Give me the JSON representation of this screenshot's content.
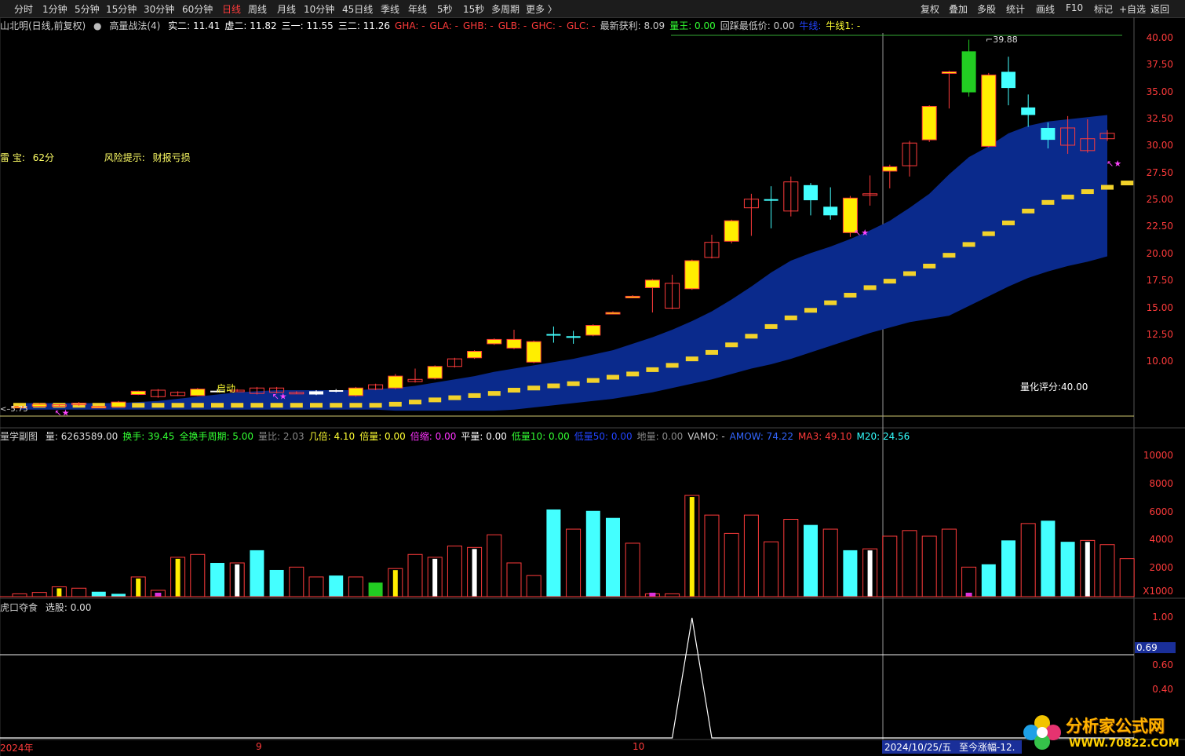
{
  "toolbar": {
    "timeframes": [
      {
        "label": "分时",
        "active": false
      },
      {
        "label": "1分钟",
        "active": false
      },
      {
        "label": "5分钟",
        "active": false
      },
      {
        "label": "15分钟",
        "active": false
      },
      {
        "label": "30分钟",
        "active": false
      },
      {
        "label": "60分钟",
        "active": false
      },
      {
        "label": "日线",
        "active": true
      },
      {
        "label": "周线",
        "active": false
      },
      {
        "label": "月线",
        "active": false
      },
      {
        "label": "10分钟",
        "active": false
      },
      {
        "label": "45日线",
        "active": false
      },
      {
        "label": "季线",
        "active": false
      },
      {
        "label": "年线",
        "active": false
      },
      {
        "label": "5秒",
        "active": false
      },
      {
        "label": "15秒",
        "active": false
      },
      {
        "label": "多周期",
        "active": false
      },
      {
        "label": "更多",
        "active": false
      }
    ],
    "more_arrow": "〉",
    "right_buttons": [
      "复权",
      "叠加",
      "多股",
      "统计",
      "画线",
      "F10",
      "标记",
      "+自选",
      "返回"
    ]
  },
  "main_header": {
    "stock": "山北明(日线,前复权)",
    "formula": "高量战法(4)",
    "items": [
      {
        "label": "实二: 11.41",
        "color": "#ffffff"
      },
      {
        "label": "虚二: 11.82",
        "color": "#ffffff"
      },
      {
        "label": "三一: 11.55",
        "color": "#ffffff"
      },
      {
        "label": "三二: 11.26",
        "color": "#ffffff"
      },
      {
        "label": "GHA: -",
        "color": "#ff3b3b"
      },
      {
        "label": "GLA: -",
        "color": "#ff3b3b"
      },
      {
        "label": "GHB: -",
        "color": "#ff3b3b"
      },
      {
        "label": "GLB: -",
        "color": "#ff3b3b"
      },
      {
        "label": "GHC: -",
        "color": "#ff3b3b"
      },
      {
        "label": "GLC: -",
        "color": "#ff3b3b"
      },
      {
        "label": "最新获利: 8.09",
        "color": "#cccccc"
      },
      {
        "label": "量王: 0.00",
        "color": "#33ff33"
      },
      {
        "label": "回踩最低价: 0.00",
        "color": "#cccccc"
      },
      {
        "label": "牛线:",
        "color": "#2244ff"
      },
      {
        "label": "牛线1: -",
        "color": "#ffff33"
      }
    ]
  },
  "leishen": {
    "label": "雷 宝:",
    "value": "62分",
    "risk_label": "风险提示:",
    "risk_value": "财报亏损"
  },
  "price_axis": [
    "40.00",
    "37.50",
    "35.00",
    "32.50",
    "30.00",
    "27.50",
    "25.00",
    "22.50",
    "20.00",
    "17.50",
    "15.00",
    "12.50",
    "10.00"
  ],
  "max_price_label": "39.88",
  "min_price_label": "5.75",
  "start_label": "启动",
  "quant_score": "量化评分:40.00",
  "volume_header": {
    "title": "量学副图",
    "items": [
      {
        "label": "量: 6263589.00",
        "color": "#dddddd"
      },
      {
        "label": "换手: 39.45",
        "color": "#33ff33"
      },
      {
        "label": "全换手周期: 5.00",
        "color": "#33ff33"
      },
      {
        "label": "量比: 2.03",
        "color": "#888888"
      },
      {
        "label": "几倍: 4.10",
        "color": "#ffff33"
      },
      {
        "label": "倍量: 0.00",
        "color": "#ffff33"
      },
      {
        "label": "倍缩: 0.00",
        "color": "#ff33ff"
      },
      {
        "label": "平量: 0.00",
        "color": "#ffffff"
      },
      {
        "label": "低量10: 0.00",
        "color": "#33ff33"
      },
      {
        "label": "低量50: 0.00",
        "color": "#2244ff"
      },
      {
        "label": "地量: 0.00",
        "color": "#888888"
      },
      {
        "label": "VAMO: -",
        "color": "#cccccc"
      },
      {
        "label": "AMOW: 74.22",
        "color": "#3366ff"
      },
      {
        "label": "MA3: 49.10",
        "color": "#ff3b3b"
      },
      {
        "label": "M20: 24.56",
        "color": "#33ffff"
      }
    ]
  },
  "volume_axis": [
    "10000",
    "8000",
    "6000",
    "4000",
    "2000"
  ],
  "volume_unit": "X1000",
  "signal_header": {
    "title": "虎口夺食",
    "item": "选股: 0.00"
  },
  "signal_axis": [
    "1.00",
    "0.60",
    "0.40"
  ],
  "signal_cursor_value": "0.69",
  "date_axis": [
    "2024年",
    "9",
    "10"
  ],
  "cursor_date": "2024/10/25/五",
  "cursor_note": "至今涨幅-12.",
  "watermark": {
    "title": "分析家公式网",
    "url": "WWW.70822.COM"
  },
  "chart_data": {
    "type": "candlestick",
    "candles": [
      {
        "o": 5.9,
        "c": 5.9,
        "h": 5.95,
        "l": 5.85,
        "kind": "up"
      },
      {
        "o": 5.9,
        "c": 6.1,
        "h": 6.2,
        "l": 5.85,
        "kind": "up"
      },
      {
        "o": 6.05,
        "c": 6.0,
        "h": 6.1,
        "l": 5.9,
        "kind": "mark"
      },
      {
        "o": 6.05,
        "c": 6.2,
        "h": 6.3,
        "l": 5.95,
        "kind": "down"
      },
      {
        "o": 5.9,
        "c": 5.9,
        "h": 5.95,
        "l": 5.8,
        "kind": "up"
      },
      {
        "o": 5.85,
        "c": 6.3,
        "h": 6.4,
        "l": 5.8,
        "kind": "up"
      },
      {
        "o": 7.0,
        "c": 7.3,
        "h": 7.35,
        "l": 6.95,
        "kind": "up"
      },
      {
        "o": 7.4,
        "c": 6.8,
        "h": 7.5,
        "l": 6.7,
        "kind": "hollow"
      },
      {
        "o": 7.2,
        "c": 6.9,
        "h": 7.3,
        "l": 6.85,
        "kind": "down"
      },
      {
        "o": 6.9,
        "c": 7.5,
        "h": 7.6,
        "l": 6.85,
        "kind": "up"
      },
      {
        "o": 7.3,
        "c": 7.35,
        "h": 7.5,
        "l": 7.2,
        "kind": "flat"
      },
      {
        "o": 7.4,
        "c": 7.4,
        "h": 7.5,
        "l": 7.3,
        "kind": "down"
      },
      {
        "o": 7.1,
        "c": 7.6,
        "h": 7.7,
        "l": 7.0,
        "kind": "hollow"
      },
      {
        "o": 7.6,
        "c": 7.2,
        "h": 7.7,
        "l": 7.1,
        "kind": "mark"
      },
      {
        "o": 7.1,
        "c": 7.2,
        "h": 7.3,
        "l": 7.05,
        "kind": "down"
      },
      {
        "o": 7.0,
        "c": 7.3,
        "h": 7.4,
        "l": 6.95,
        "kind": "flat"
      },
      {
        "o": 7.3,
        "c": 7.4,
        "h": 7.5,
        "l": 7.2,
        "kind": "flat"
      },
      {
        "o": 6.9,
        "c": 7.6,
        "h": 7.7,
        "l": 6.8,
        "kind": "up"
      },
      {
        "o": 7.5,
        "c": 7.9,
        "h": 8.0,
        "l": 7.4,
        "kind": "hollow"
      },
      {
        "o": 7.6,
        "c": 8.7,
        "h": 8.9,
        "l": 7.5,
        "kind": "up"
      },
      {
        "o": 8.2,
        "c": 8.4,
        "h": 9.4,
        "l": 8.1,
        "kind": "hollow"
      },
      {
        "o": 8.5,
        "c": 9.6,
        "h": 9.7,
        "l": 8.4,
        "kind": "up"
      },
      {
        "o": 9.6,
        "c": 10.3,
        "h": 10.4,
        "l": 9.5,
        "kind": "hollow"
      },
      {
        "o": 10.4,
        "c": 11.0,
        "h": 11.1,
        "l": 10.3,
        "kind": "up"
      },
      {
        "o": 11.7,
        "c": 12.1,
        "h": 12.2,
        "l": 11.6,
        "kind": "up"
      },
      {
        "o": 12.1,
        "c": 11.3,
        "h": 13.0,
        "l": 11.2,
        "kind": "up"
      },
      {
        "o": 11.9,
        "c": 10.0,
        "h": 12.0,
        "l": 9.9,
        "kind": "up"
      },
      {
        "o": 12.5,
        "c": 12.6,
        "h": 13.3,
        "l": 11.8,
        "kind": "cyan"
      },
      {
        "o": 12.3,
        "c": 12.4,
        "h": 12.9,
        "l": 11.7,
        "kind": "cyan"
      },
      {
        "o": 12.5,
        "c": 13.4,
        "h": 13.5,
        "l": 12.4,
        "kind": "up"
      },
      {
        "o": 14.6,
        "c": 14.6,
        "h": 14.7,
        "l": 14.5,
        "kind": "up"
      },
      {
        "o": 16.1,
        "c": 16.1,
        "h": 16.2,
        "l": 16.0,
        "kind": "up"
      },
      {
        "o": 17.6,
        "c": 16.9,
        "h": 17.7,
        "l": 14.6,
        "kind": "up"
      },
      {
        "o": 15.0,
        "c": 17.3,
        "h": 18.1,
        "l": 14.9,
        "kind": "hollow"
      },
      {
        "o": 16.8,
        "c": 19.4,
        "h": 19.5,
        "l": 16.7,
        "kind": "up"
      },
      {
        "o": 19.7,
        "c": 21.1,
        "h": 21.8,
        "l": 19.6,
        "kind": "hollow"
      },
      {
        "o": 21.2,
        "c": 23.1,
        "h": 23.2,
        "l": 21.0,
        "kind": "up"
      },
      {
        "o": 24.3,
        "c": 25.1,
        "h": 25.6,
        "l": 21.7,
        "kind": "hollow"
      },
      {
        "o": 25.1,
        "c": 25.1,
        "h": 26.3,
        "l": 22.4,
        "kind": "cyan"
      },
      {
        "o": 24.0,
        "c": 26.7,
        "h": 27.2,
        "l": 23.5,
        "kind": "hollow"
      },
      {
        "o": 26.4,
        "c": 25.0,
        "h": 26.6,
        "l": 23.6,
        "kind": "cyan"
      },
      {
        "o": 24.4,
        "c": 23.6,
        "h": 26.2,
        "l": 23.2,
        "kind": "cyan"
      },
      {
        "o": 22.0,
        "c": 25.2,
        "h": 25.4,
        "l": 21.6,
        "kind": "up"
      },
      {
        "o": 25.5,
        "c": 25.6,
        "h": 27.3,
        "l": 24.5,
        "kind": "hollow"
      },
      {
        "o": 27.7,
        "c": 28.1,
        "h": 28.3,
        "l": 26.1,
        "kind": "up"
      },
      {
        "o": 28.2,
        "c": 30.3,
        "h": 30.5,
        "l": 27.2,
        "kind": "hollow"
      },
      {
        "o": 30.6,
        "c": 33.7,
        "h": 33.8,
        "l": 30.4,
        "kind": "up"
      },
      {
        "o": 36.8,
        "c": 36.9,
        "h": 37.0,
        "l": 33.5,
        "kind": "up"
      },
      {
        "o": 38.8,
        "c": 35.0,
        "h": 39.88,
        "l": 34.6,
        "kind": "green"
      },
      {
        "o": 36.6,
        "c": 30.0,
        "h": 36.8,
        "l": 29.9,
        "kind": "up"
      },
      {
        "o": 35.4,
        "c": 36.9,
        "h": 38.3,
        "l": 33.8,
        "kind": "cyan"
      },
      {
        "o": 33.6,
        "c": 32.9,
        "h": 34.8,
        "l": 31.8,
        "kind": "cyan"
      },
      {
        "o": 31.7,
        "c": 30.6,
        "h": 32.2,
        "l": 29.8,
        "kind": "cyan"
      },
      {
        "o": 30.1,
        "c": 31.7,
        "h": 32.8,
        "l": 29.3,
        "kind": "hollow"
      },
      {
        "o": 29.6,
        "c": 30.7,
        "h": 32.5,
        "l": 29.4,
        "kind": "hollow"
      },
      {
        "o": 30.7,
        "c": 31.2,
        "h": 31.5,
        "l": 30.5,
        "kind": "hollow"
      }
    ],
    "band_upper": [
      6.2,
      6.2,
      6.2,
      6.2,
      6.2,
      6.2,
      6.3,
      6.4,
      6.6,
      6.8,
      7.0,
      7.2,
      7.3,
      7.4,
      7.4,
      7.4,
      7.4,
      7.4,
      7.5,
      7.6,
      7.8,
      8.1,
      8.4,
      8.7,
      9.1,
      9.4,
      9.7,
      10.0,
      10.3,
      10.7,
      11.1,
      11.7,
      12.3,
      13.0,
      13.8,
      14.7,
      15.8,
      17.0,
      18.3,
      19.4,
      20.1,
      20.7,
      21.4,
      22.2,
      23.1,
      24.3,
      25.6,
      27.4,
      29.0,
      30.0,
      31.2,
      31.9,
      32.3,
      32.5,
      32.7,
      32.9
    ],
    "band_lower": [
      5.6,
      5.6,
      5.6,
      5.6,
      5.6,
      5.6,
      5.6,
      5.6,
      5.6,
      5.6,
      5.6,
      5.6,
      5.6,
      5.6,
      5.6,
      5.6,
      5.6,
      5.6,
      5.6,
      5.5,
      5.5,
      5.5,
      5.5,
      5.5,
      5.5,
      5.6,
      5.8,
      6.0,
      6.2,
      6.4,
      6.6,
      6.9,
      7.2,
      7.6,
      8.0,
      8.4,
      8.9,
      9.4,
      9.8,
      10.3,
      10.9,
      11.5,
      12.1,
      12.7,
      13.2,
      13.7,
      14.0,
      14.3,
      15.2,
      16.1,
      17.0,
      17.8,
      18.4,
      18.9,
      19.3,
      19.8
    ],
    "center_line": [
      6.0,
      6.0,
      6.0,
      6.0,
      6.0,
      6.0,
      6.0,
      6.0,
      6.0,
      6.0,
      6.0,
      6.0,
      6.0,
      6.0,
      6.0,
      6.0,
      6.0,
      6.0,
      6.0,
      6.1,
      6.3,
      6.5,
      6.7,
      6.9,
      7.1,
      7.4,
      7.6,
      7.8,
      8.0,
      8.3,
      8.6,
      8.9,
      9.3,
      9.7,
      10.3,
      10.9,
      11.6,
      12.4,
      13.3,
      14.1,
      14.8,
      15.5,
      16.2,
      16.9,
      17.5,
      18.2,
      18.9,
      19.9,
      20.9,
      21.9,
      22.9,
      24.0,
      24.8,
      25.3,
      25.8,
      26.2,
      26.6
    ],
    "volume_x1000": [
      200,
      300,
      700,
      600,
      350,
      200,
      1400,
      450,
      2800,
      3000,
      2400,
      2400,
      3300,
      1900,
      2100,
      1400,
      1500,
      1400,
      1000,
      2000,
      3000,
      2800,
      3600,
      3500,
      4400,
      2400,
      1500,
      6200,
      4800,
      6100,
      5600,
      3800,
      200,
      200,
      7200,
      5800,
      4500,
      5800,
      3900,
      5500,
      5100,
      4800,
      3300,
      3400,
      4300,
      4700,
      4300,
      4800,
      2100,
      2300,
      4000,
      5200,
      5400,
      3900,
      4000,
      3700,
      2700
    ],
    "volume_kinds": [
      "hollow",
      "hollow",
      "up",
      "hollow",
      "cyan",
      "cyan",
      "up",
      "mag",
      "up",
      "hollow",
      "cyan",
      "white",
      "cyan",
      "cyan",
      "hollow",
      "hollow",
      "cyan",
      "hollow",
      "green",
      "up",
      "hollow",
      "white",
      "hollow",
      "white",
      "hollow",
      "hollow",
      "hollow",
      "cyan",
      "hollow",
      "cyan",
      "cyan",
      "hollow",
      "mag",
      "hollow",
      "up",
      "hollow",
      "hollow",
      "hollow",
      "hollow",
      "hollow",
      "cyan",
      "hollow",
      "cyan",
      "white",
      "hollow",
      "hollow",
      "hollow",
      "hollow",
      "mag",
      "cyan",
      "cyan",
      "hollow",
      "cyan",
      "cyan",
      "white",
      "hollow",
      "hollow"
    ],
    "signal_peak_index": 34,
    "ylim": [
      5.0,
      40.5
    ]
  }
}
